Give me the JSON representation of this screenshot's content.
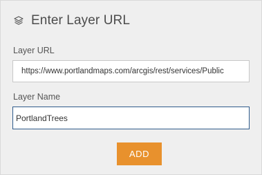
{
  "header": {
    "icon": "layers-icon",
    "title": "Enter Layer URL"
  },
  "form": {
    "layer_url": {
      "label": "Layer URL",
      "value": "https://www.portlandmaps.com/arcgis/rest/services/Public"
    },
    "layer_name": {
      "label": "Layer Name",
      "value": "PortlandTrees"
    },
    "add_label": "ADD"
  },
  "colors": {
    "panel_background": "#efefef",
    "button": "#e8912d",
    "focused_border": "#2e5a8a"
  }
}
